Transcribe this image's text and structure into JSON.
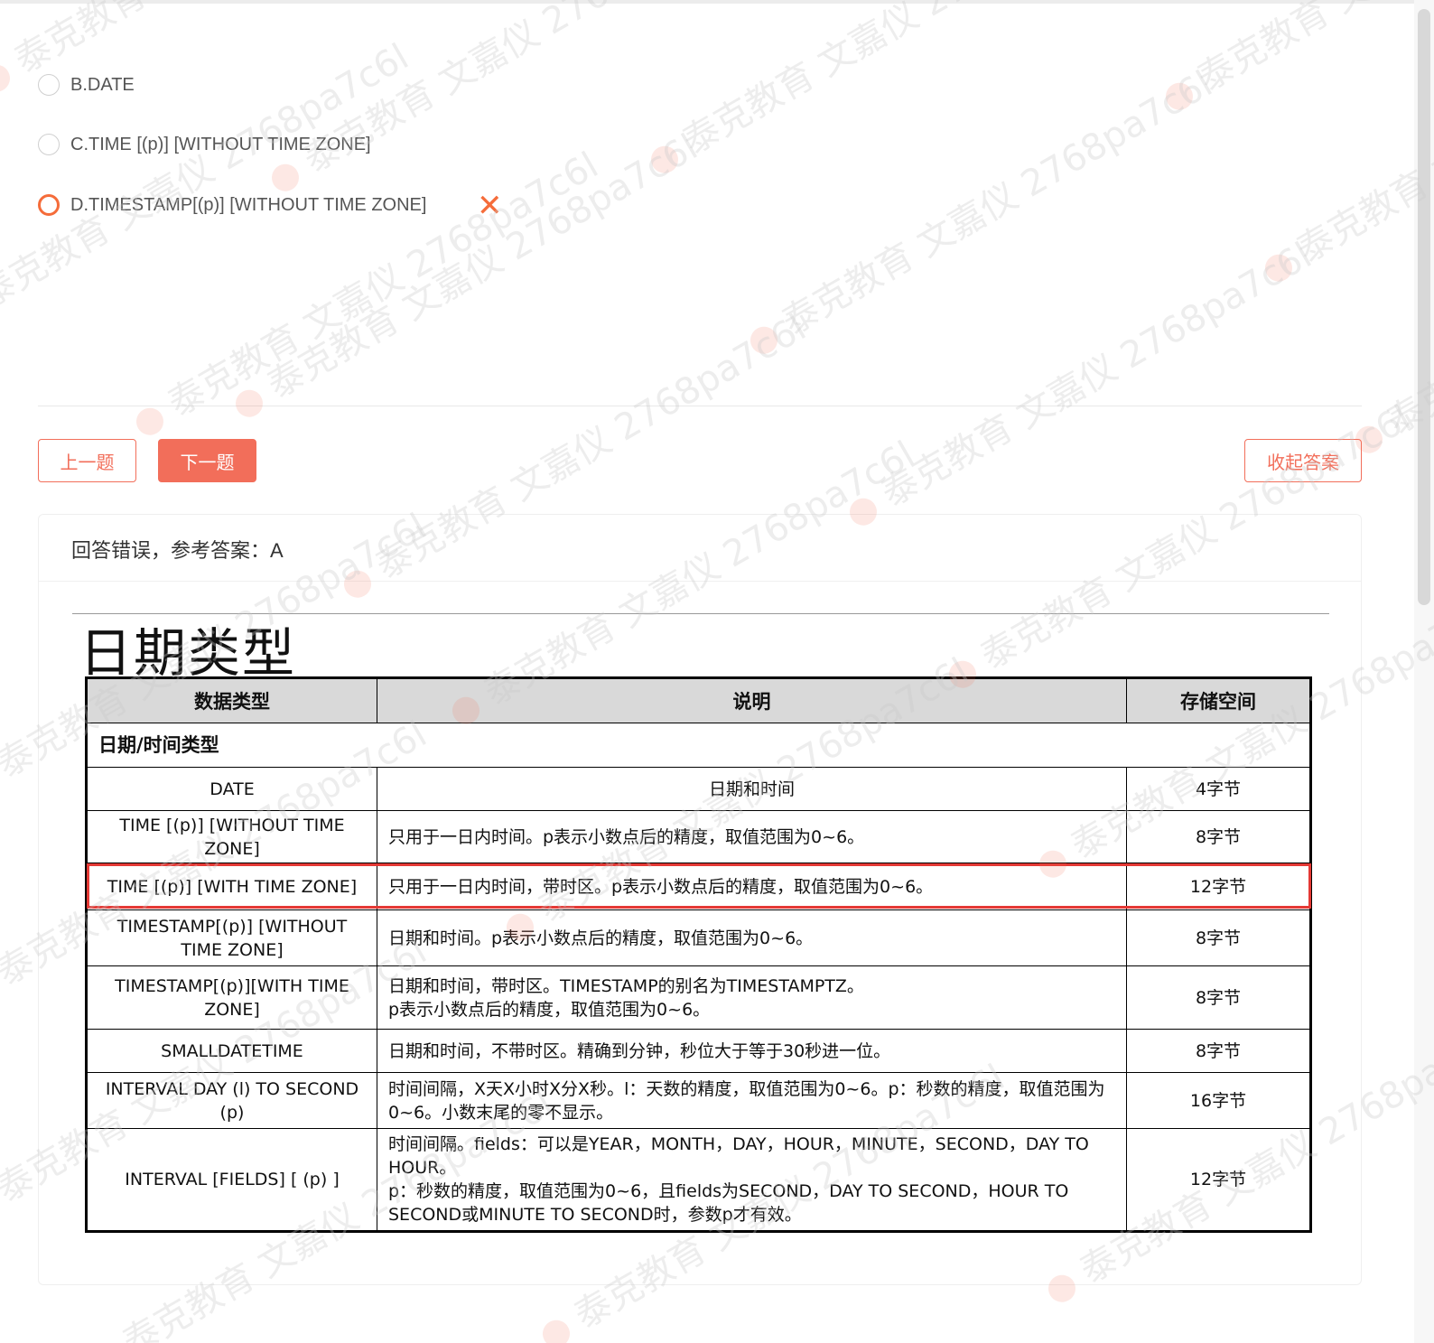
{
  "options": [
    {
      "label": "B.DATE",
      "selected": false
    },
    {
      "label": "C.TIME [(p)]  [WITHOUT TIME ZONE]",
      "selected": false
    },
    {
      "label": "D.TIMESTAMP[(p)] [WITHOUT TIME ZONE]",
      "selected": true,
      "wrong": true
    }
  ],
  "buttons": {
    "prev": "上一题",
    "next": "下一题",
    "collapse": "收起答案"
  },
  "answer": {
    "result": "回答错误，参考答案：A"
  },
  "explanation": {
    "title": "日期类型",
    "headers": [
      "数据类型",
      "说明",
      "存储空间"
    ],
    "section": "日期/时间类型",
    "rows": [
      {
        "type": "DATE",
        "desc": "日期和时间",
        "size": "4字节"
      },
      {
        "type": "TIME [(p)] [WITHOUT TIME ZONE]",
        "desc": "只用于一日内时间。p表示小数点后的精度，取值范围为0~6。",
        "size": "8字节"
      },
      {
        "type": "TIME [(p)] [WITH TIME ZONE]",
        "desc": "只用于一日内时间，带时区。p表示小数点后的精度，取值范围为0~6。",
        "size": "12字节"
      },
      {
        "type": "TIMESTAMP[(p)] [WITHOUT TIME ZONE]",
        "desc": "日期和时间。p表示小数点后的精度，取值范围为0~6。",
        "size": "8字节"
      },
      {
        "type": "TIMESTAMP[(p)][WITH TIME ZONE]",
        "desc": "日期和时间，带时区。TIMESTAMP的别名为TIMESTAMPTZ。\np表示小数点后的精度，取值范围为0~6。",
        "size": "8字节"
      },
      {
        "type": "SMALLDATETIME",
        "desc": "日期和时间，不带时区。精确到分钟，秒位大于等于30秒进一位。",
        "size": "8字节"
      },
      {
        "type": "INTERVAL DAY (l) TO SECOND (p)",
        "desc": "时间间隔，X天X小时X分X秒。l：天数的精度，取值范围为0~6。p：秒数的精度，取值范围为0~6。小数末尾的零不显示。",
        "size": "16字节"
      },
      {
        "type": "INTERVAL [FIELDS] [ (p) ]",
        "desc": "时间间隔。fields：可以是YEAR，MONTH，DAY，HOUR，MINUTE，SECOND，DAY TO HOUR。\np：秒数的精度，取值范围为0~6，且fields为SECOND，DAY TO SECOND，HOUR TO SECOND或MINUTE TO SECOND时，参数p才有效。",
        "size": "12字节"
      }
    ]
  },
  "watermark": {
    "text": "泰克教育 文嘉仪 2768pa7c6l"
  },
  "colors": {
    "accent": "#f26e5a",
    "wrong": "#f56c3a",
    "highlight": "#e53935"
  }
}
